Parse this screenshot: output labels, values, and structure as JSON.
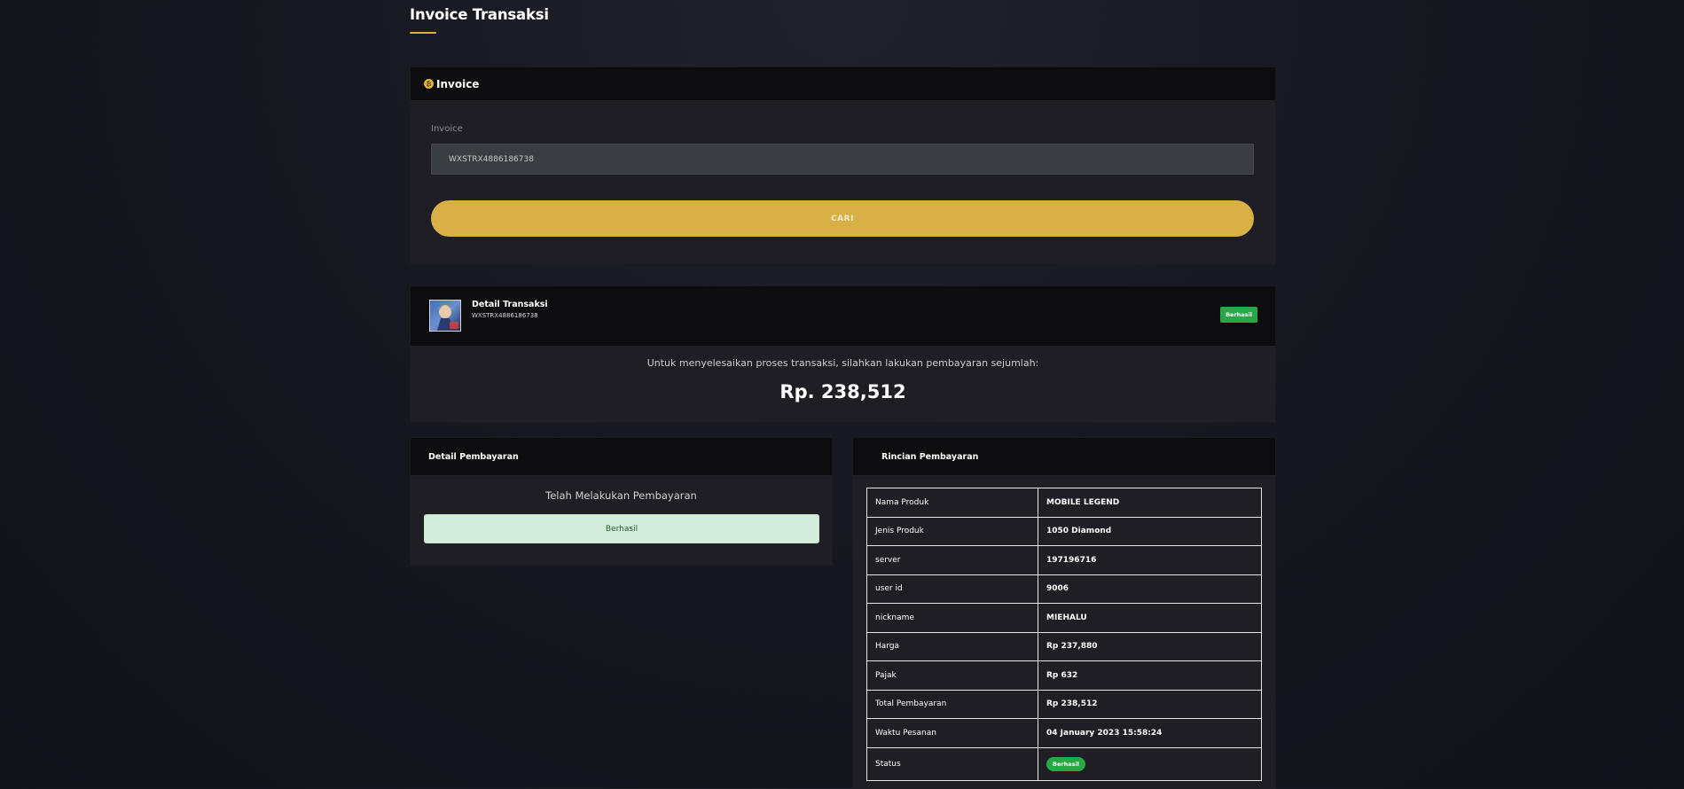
{
  "page": {
    "title": "Invoice Transaksi"
  },
  "invoice_form": {
    "card_title": "Invoice",
    "field_label": "Invoice",
    "invoice_value": "WXSTRX4886186738",
    "search_button": "CARI"
  },
  "transaction": {
    "title": "Detail Transaksi",
    "invoice_id": "WXSTRX4886186738",
    "status": "Berhasil",
    "instruction": "Untuk menyelesaikan proses transaksi, silahkan lakukan pembayaran sejumlah:",
    "amount": "Rp. 238,512"
  },
  "payment_detail": {
    "title": "Detail Pembayaran",
    "message": "Telah Melakukan Pembayaran",
    "status": "Berhasil"
  },
  "rincian": {
    "title": "Rincian Pembayaran",
    "rows": [
      {
        "label": "Nama Produk",
        "value": "MOBILE LEGEND"
      },
      {
        "label": "Jenis Produk",
        "value": "1050 Diamond"
      },
      {
        "label": "server",
        "value": "197196716"
      },
      {
        "label": "user id",
        "value": "9006"
      },
      {
        "label": "nickname",
        "value": "MIEHALU"
      },
      {
        "label": "Harga",
        "value": "Rp 237,880"
      },
      {
        "label": "Pajak",
        "value": "Rp 632"
      },
      {
        "label": "Total Pembayaran",
        "value": "Rp 238,512"
      },
      {
        "label": "Waktu Pesanan",
        "value": "04 January 2023 15:58:24"
      },
      {
        "label": "Status",
        "value": "Berhasil"
      }
    ]
  },
  "colors": {
    "accent": "#d8b045",
    "success": "#28a745",
    "success_light": "#d4edda",
    "background": "#17171f"
  }
}
